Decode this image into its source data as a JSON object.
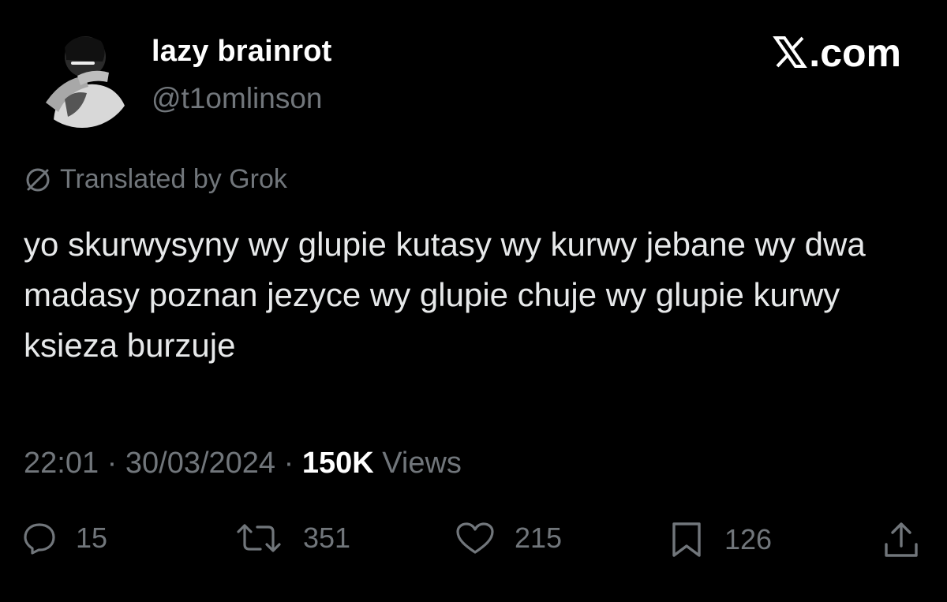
{
  "user": {
    "display_name": "lazy brainrot",
    "handle": "@t1omlinson",
    "avatar_icon": "profile-photo"
  },
  "source": {
    "site": ".com",
    "logo_icon": "x-logo"
  },
  "translation": {
    "label": "Translated by Grok",
    "icon": "globe-slash-icon"
  },
  "tweet": {
    "text": "yo skurwysyny wy glupie kutasy wy kurwy jebane wy dwa madasy poznan jezyce wy glupie chuje wy glupie kurwy ksieza burzuje"
  },
  "meta": {
    "time": "22:01",
    "separator1": " · ",
    "date": "30/03/2024",
    "separator2": " · ",
    "views_count": "150K",
    "views_label": " Views"
  },
  "actions": {
    "replies": "15",
    "reposts": "351",
    "likes": "215",
    "bookmarks": "126"
  },
  "colors": {
    "background": "#000000",
    "primary_text": "#e7e9ea",
    "secondary_text": "#71767b"
  }
}
